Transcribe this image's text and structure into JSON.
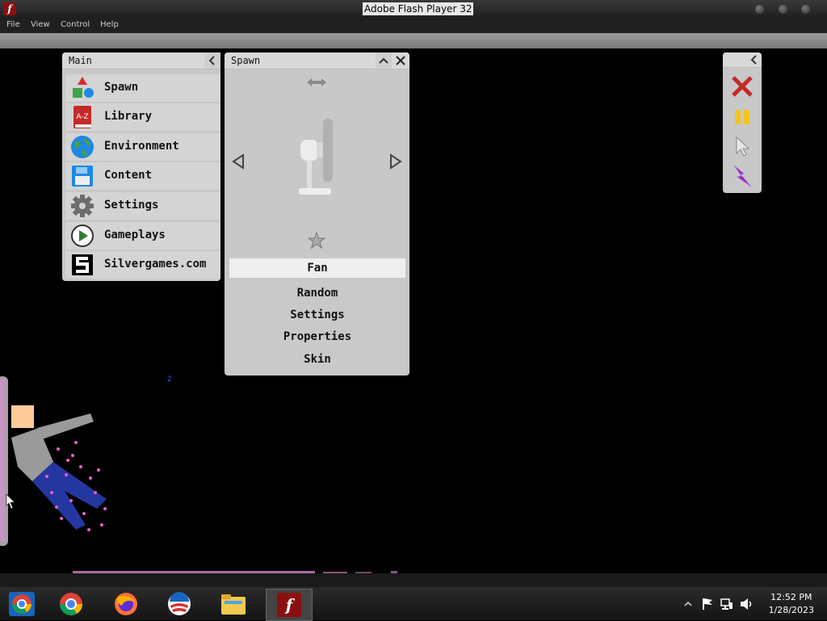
{
  "window": {
    "title": "Adobe Flash Player 32",
    "menus": [
      "File",
      "View",
      "Control",
      "Help"
    ]
  },
  "main_panel": {
    "title": "Main",
    "items": [
      {
        "label": "Spawn",
        "icon": "shapes-icon"
      },
      {
        "label": "Library",
        "icon": "book-icon"
      },
      {
        "label": "Environment",
        "icon": "globe-icon"
      },
      {
        "label": "Content",
        "icon": "floppy-disk-icon"
      },
      {
        "label": "Settings",
        "icon": "gear-icon"
      },
      {
        "label": "Gameplays",
        "icon": "play-icon"
      },
      {
        "label": "Silvergames.com",
        "icon": "silvergames-logo-icon"
      }
    ]
  },
  "spawn_panel": {
    "title": "Spawn",
    "selected_item": "Fan",
    "options": [
      "Random",
      "Settings",
      "Properties",
      "Skin"
    ]
  },
  "tool_panel": {
    "tools": [
      "close-icon",
      "pause-icon",
      "cursor-icon",
      "lightning-icon"
    ]
  },
  "stage": {
    "stray_text": "2"
  },
  "taskbar": {
    "apps": [
      "chrome-icon",
      "chrome-icon",
      "firefox-icon",
      "obama-logo-icon",
      "file-explorer-icon",
      "flash-player-icon"
    ],
    "time": "12:52 PM",
    "date": "1/28/2023"
  },
  "colors": {
    "panel_bg": "#c8c8c8",
    "selected_bg": "#eeeeee",
    "stage_bg": "#000000",
    "accent_red": "#c62828",
    "accent_yellow": "#f5c518",
    "accent_purple": "#8e24aa"
  }
}
